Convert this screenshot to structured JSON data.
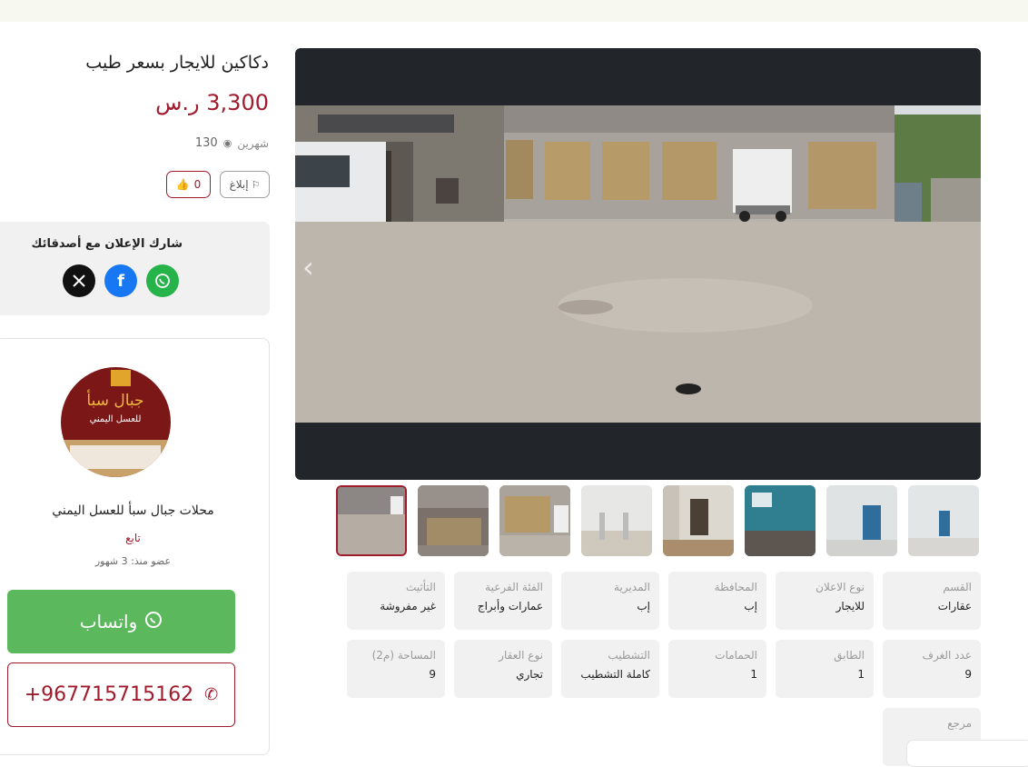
{
  "listing": {
    "title": "دكاكين للايجار بسعر طيب",
    "price": "3,300 ر.س",
    "posted": "شهرين",
    "views": "130",
    "report_label": "إبلاغ",
    "likes": "0"
  },
  "share": {
    "title": "شارك الإعلان مع أصدقائك",
    "icons": [
      "x-icon",
      "facebook-icon",
      "whatsapp-icon"
    ]
  },
  "seller": {
    "name": "محلات جبال سبأ للعسل اليمني",
    "follow_label": "تابع",
    "member_since_label": "عضو منذ:",
    "member_since_value": "3 شهور",
    "logo_text_line1": "جبال سبأ",
    "logo_text_line2": "للعسل اليمني",
    "whatsapp_label": "واتساب",
    "phone": "+967715715162"
  },
  "specs": [
    {
      "label": "القسم",
      "value": "عقارات"
    },
    {
      "label": "نوع الاعلان",
      "value": "للايجار"
    },
    {
      "label": "المحافظة",
      "value": "إب"
    },
    {
      "label": "المديرية",
      "value": "إب"
    },
    {
      "label": "الفئة الفرعية",
      "value": "عمارات وأبراج"
    },
    {
      "label": "التأثيث",
      "value": "غير مفروشة"
    },
    {
      "label": "عدد الغرف",
      "value": "9"
    },
    {
      "label": "الطابق",
      "value": "1"
    },
    {
      "label": "الحمامات",
      "value": "1"
    },
    {
      "label": "التشطيب",
      "value": "كاملة التشطيب"
    },
    {
      "label": "نوع العقار",
      "value": "تجاري"
    },
    {
      "label": "المساحة (م2)",
      "value": "9"
    },
    {
      "label": "مرجع",
      "value": ""
    }
  ],
  "gallery": {
    "thumb_count": 8,
    "active_index": 0
  },
  "colors": {
    "accent": "#a01b2c",
    "whatsapp": "#5cb85c",
    "facebook": "#1877f2",
    "x": "#111111",
    "panel": "#f1f1f1"
  }
}
